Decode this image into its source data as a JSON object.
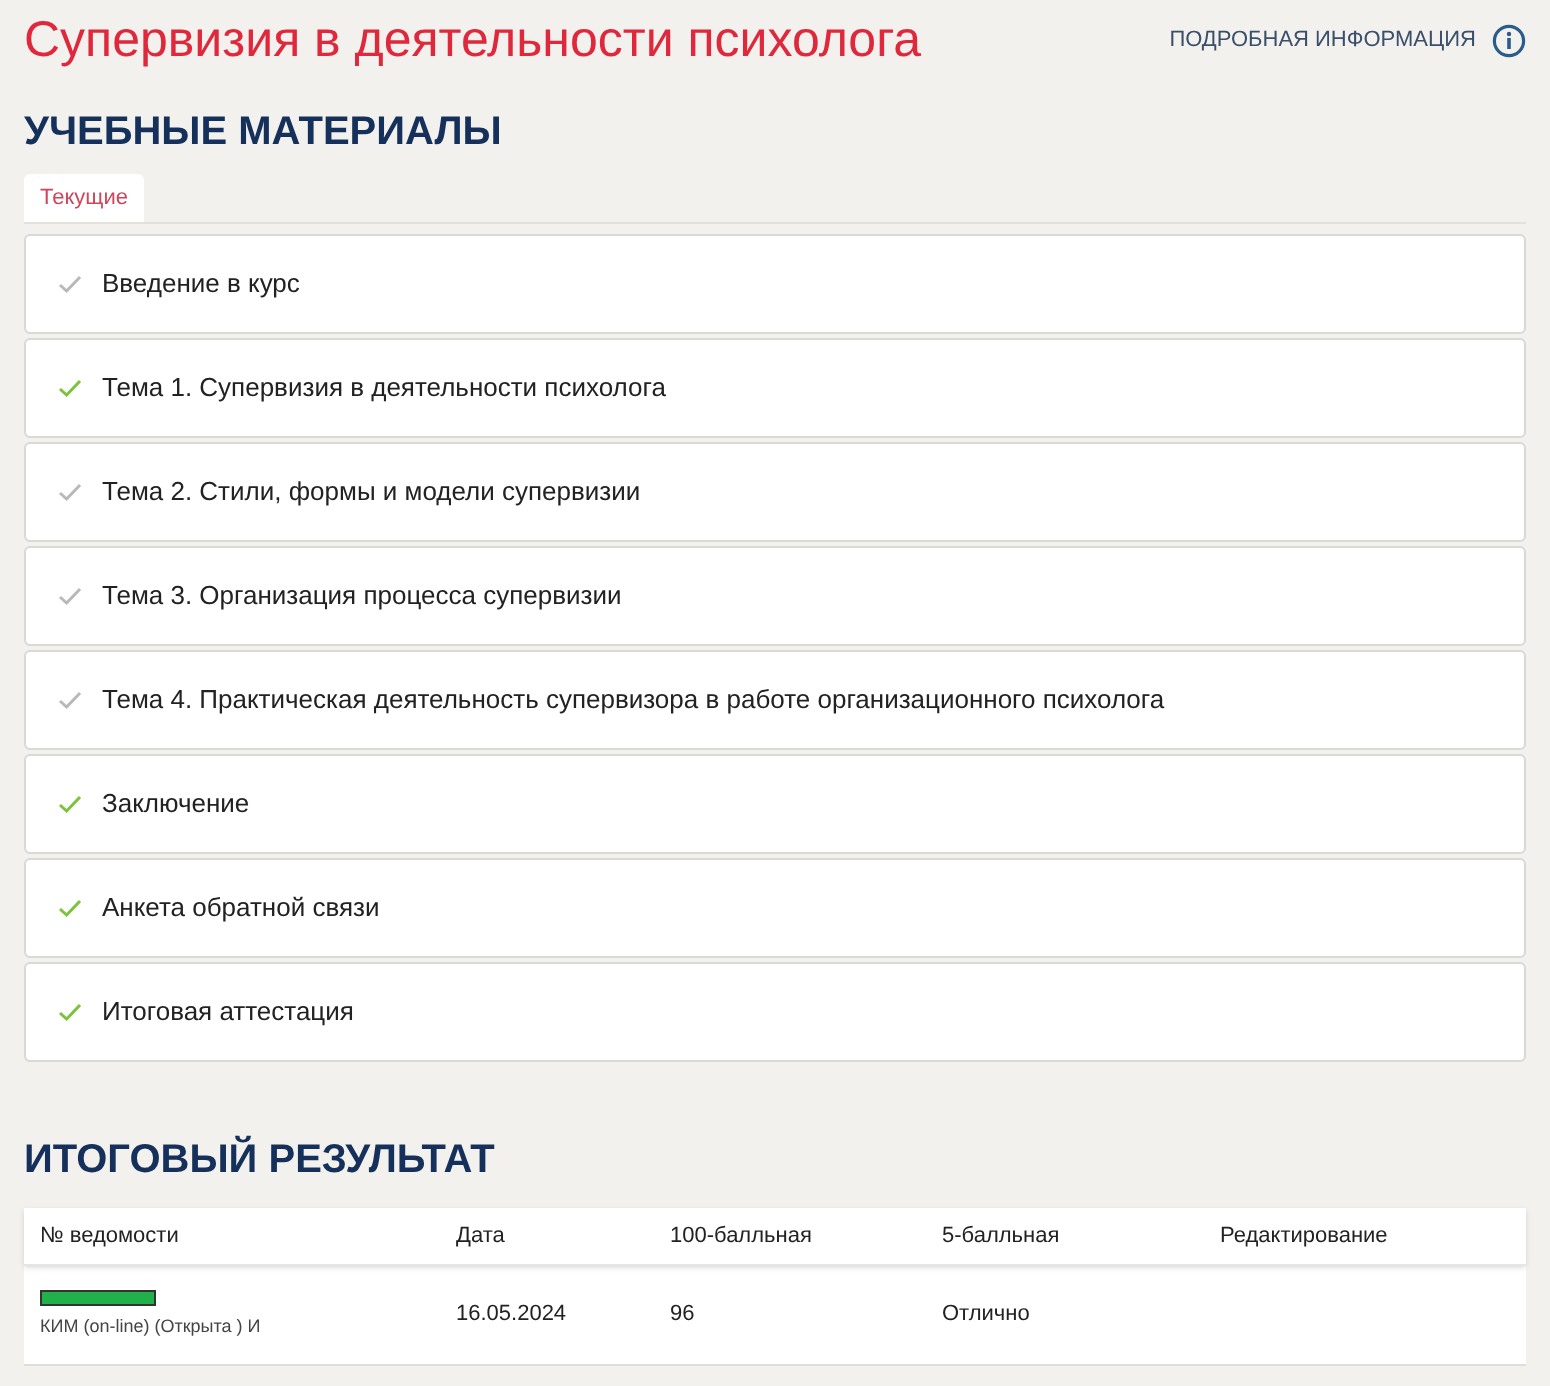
{
  "title": "Супервизия в деятельности психолога",
  "info_link": "ПОДРОБНАЯ ИНФОРМАЦИЯ",
  "materials": {
    "heading": "УЧЕБНЫЕ МАТЕРИАЛЫ",
    "tabs": [
      {
        "label": "Текущие",
        "selected": true
      }
    ],
    "items": [
      {
        "label": "Введение в курс",
        "done": false
      },
      {
        "label": "Тема 1. Супервизия в деятельности психолога",
        "done": true
      },
      {
        "label": "Тема 2. Стили, формы и модели супервизии",
        "done": false
      },
      {
        "label": "Тема 3. Организация процесса супервизии",
        "done": false
      },
      {
        "label": "Тема 4. Практическая деятельность супервизора в работе организационного психолога",
        "done": false
      },
      {
        "label": "Заключение",
        "done": true
      },
      {
        "label": "Анкета обратной связи",
        "done": true
      },
      {
        "label": "Итоговая аттестация",
        "done": true
      }
    ]
  },
  "result": {
    "heading": "ИТОГОВЫЙ РЕЗУЛЬТАТ",
    "table": {
      "columns": [
        "№ ведомости",
        "Дата",
        "100-балльная",
        "5-балльная",
        "Редактирование"
      ],
      "rows": [
        {
          "level": 1,
          "sheet": "КИМ (on-line) (Открыта ) И",
          "date": "16.05.2024",
          "score_100": "96",
          "score_5": "Отлично"
        }
      ]
    }
  }
}
